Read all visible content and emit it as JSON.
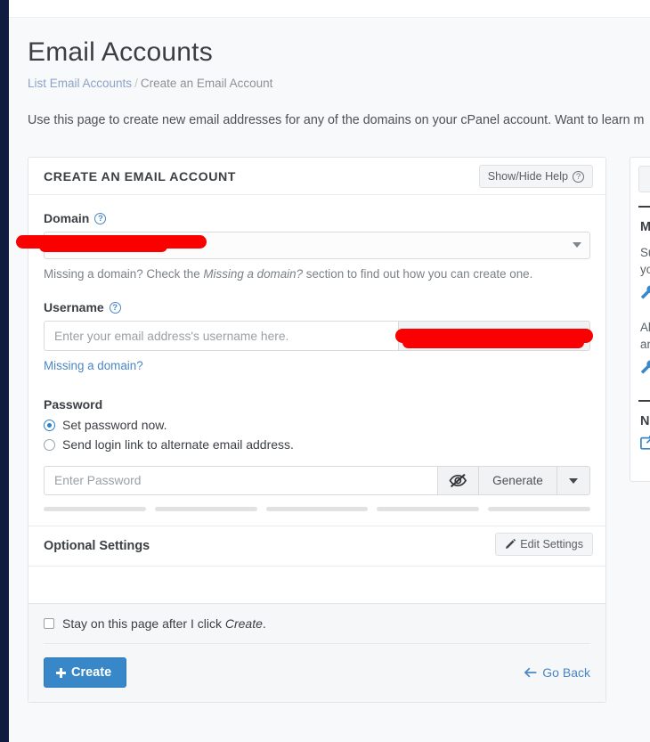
{
  "page": {
    "title": "Email Accounts",
    "breadcrumb": {
      "parent": "List Email Accounts",
      "separator": "/",
      "current": "Create an Email Account"
    },
    "intro": "Use this page to create new email addresses for any of the domains on your cPanel account. Want to learn m"
  },
  "card": {
    "header": "CREATE AN EMAIL ACCOUNT",
    "help_button": {
      "label": "Show/Hide Help",
      "icon": "question-circle-icon"
    },
    "domain": {
      "label": "Domain",
      "help_icon": "question-circle-icon",
      "value": "",
      "caret_icon": "chevron-down-icon",
      "hint_before": "Missing a domain? Check the ",
      "hint_italic": "Missing a domain?",
      "hint_after": " section to find out how you can create one."
    },
    "username": {
      "label": "Username",
      "help_icon": "question-circle-icon",
      "value": "",
      "placeholder": "Enter your email address's username here.",
      "addon_value": "",
      "link": "Missing a domain?"
    },
    "password": {
      "label": "Password",
      "options": [
        {
          "label": "Set password now.",
          "selected": true
        },
        {
          "label": "Send login link to alternate email address.",
          "selected": false
        }
      ],
      "value": "",
      "placeholder": "Enter Password",
      "toggle_icon": "eye-slash-icon",
      "generate_label": "Generate",
      "dropdown_icon": "caret-down-icon",
      "strength_segments": 5
    },
    "optional": {
      "title": "Optional Settings",
      "edit_button": {
        "label": "Edit Settings",
        "icon": "pencil-icon"
      }
    },
    "footer": {
      "stay_checkbox": {
        "checked": false,
        "text_before": "Stay on this page after I click ",
        "text_italic": "Create",
        "text_after": "."
      },
      "create_button": {
        "label": "Create",
        "icon": "plus-icon"
      },
      "go_back": {
        "label": "Go Back",
        "icon": "arrow-left-icon"
      }
    }
  },
  "sidebar": {
    "heading_1": "M",
    "text_1a": "Su",
    "text_1b": "yo",
    "icon_1": "wrench-icon",
    "text_2a": "Ali",
    "text_2b": "an",
    "icon_2": "wrench-icon",
    "heading_2": "N",
    "icon_3": "external-link-icon"
  },
  "colors": {
    "accent": "#3787c9",
    "link": "#4a86c5",
    "rail": "#0f1c3f",
    "redaction": "#fa0000",
    "page_bg": "#f8f9fa"
  }
}
